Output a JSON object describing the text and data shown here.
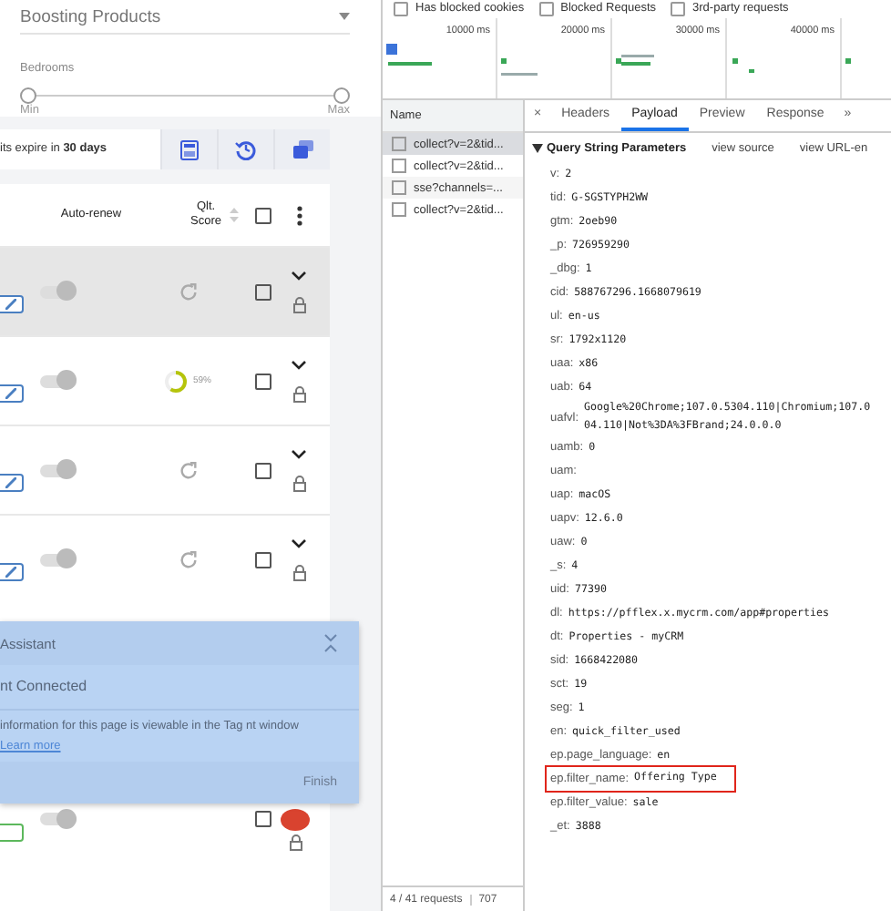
{
  "filters": {
    "dropdown": {
      "value": "Boosting Products"
    },
    "range": {
      "label": "Bedrooms",
      "thumbs": [
        {
          "level": 0
        },
        {
          "level": 1
        }
      ],
      "min_label": "Min",
      "max_label": "Max"
    }
  },
  "credits_bar": {
    "text": "its expire in **30 days**"
  },
  "table": {
    "columns": [
      {
        "label": "Auto-renew"
      },
      {
        "label": "Qlt. Score"
      }
    ],
    "header_checked": false,
    "rows": [
      {
        "selected": true,
        "auto_renew": false,
        "score": {
          "kind": "refresh"
        },
        "checked": false
      },
      {
        "selected": false,
        "auto_renew": false,
        "score": {
          "kind": "progress",
          "level": 0.59,
          "text": "59%"
        },
        "checked": false
      },
      {
        "selected": false,
        "auto_renew": false,
        "score": {
          "kind": "refresh"
        },
        "checked": false
      },
      {
        "selected": false,
        "auto_renew": false,
        "score": {
          "kind": "refresh"
        },
        "checked": false
      }
    ],
    "bottom_row": {
      "auto_renew": false,
      "checked": false
    }
  },
  "tag_assistant": {
    "title": "Assistant",
    "status": "nt Connected",
    "message": "information for this page is viewable in the Tag nt window",
    "link": "Learn more",
    "button": "Finish"
  },
  "devtools": {
    "filters": [
      {
        "label": "Has blocked cookies",
        "checked": false
      },
      {
        "label": "Blocked Requests",
        "checked": false
      },
      {
        "label": "3rd-party requests",
        "checked": false
      }
    ],
    "timeline": {
      "ticks": [
        "10000 ms",
        "20000 ms",
        "30000 ms",
        "40000 ms"
      ]
    },
    "name_column": "Name",
    "requests": [
      {
        "name": "collect?v=2&tid...",
        "selected": true
      },
      {
        "name": "collect?v=2&tid...",
        "selected": false
      },
      {
        "name": "sse?channels=...",
        "selected": false
      },
      {
        "name": "collect?v=2&tid...",
        "selected": false
      }
    ],
    "status": {
      "requests": "4 / 41 requests",
      "size": "707"
    },
    "tabs": [
      {
        "label": "Headers",
        "selected": false
      },
      {
        "label": "Payload",
        "selected": true
      },
      {
        "label": "Preview",
        "selected": false
      },
      {
        "label": "Response",
        "selected": false
      }
    ],
    "close": "×",
    "more_tabs": "»",
    "section": {
      "title": "Query String Parameters",
      "expanded": true,
      "view_source": "view source",
      "view_url": "view URL-en"
    },
    "params": [
      {
        "key": "v:",
        "value": "2"
      },
      {
        "key": "tid:",
        "value": "G-SGSTYPH2WW"
      },
      {
        "key": "gtm:",
        "value": "2oeb90"
      },
      {
        "key": "_p:",
        "value": "726959290"
      },
      {
        "key": "_dbg:",
        "value": "1"
      },
      {
        "key": "cid:",
        "value": "588767296.1668079619"
      },
      {
        "key": "ul:",
        "value": "en-us"
      },
      {
        "key": "sr:",
        "value": "1792x1120"
      },
      {
        "key": "uaa:",
        "value": "x86"
      },
      {
        "key": "uab:",
        "value": "64"
      },
      {
        "key": "uafvl:",
        "value_lines": [
          "Google%20Chrome;107.0.5304.110|Chromium;107.0",
          "04.110|Not%3DA%3FBrand;24.0.0.0"
        ]
      },
      {
        "key": "uamb:",
        "value": "0"
      },
      {
        "key": "uam:"
      },
      {
        "key": "uap:",
        "value": "macOS"
      },
      {
        "key": "uapv:",
        "value": "12.6.0"
      },
      {
        "key": "uaw:",
        "value": "0"
      },
      {
        "key": "_s:",
        "value": "4"
      },
      {
        "key": "uid:",
        "value": "77390"
      },
      {
        "key": "dl:",
        "value": "https://pfflex.x.mycrm.com/app#properties"
      },
      {
        "key": "dt:",
        "value": "Properties - myCRM"
      },
      {
        "key": "sid:",
        "value": "1668422080"
      },
      {
        "key": "sct:",
        "value": "19"
      },
      {
        "key": "seg:",
        "value": "1"
      },
      {
        "key": "en:",
        "value": "quick_filter_used"
      },
      {
        "key": "ep.page_language:",
        "value": "en"
      },
      {
        "key": "ep.filter_name:",
        "value": "Offering Type",
        "highlighted": true
      },
      {
        "key": "ep.filter_value:",
        "value": "sale"
      },
      {
        "key": "_et:",
        "value": "3888"
      }
    ]
  }
}
